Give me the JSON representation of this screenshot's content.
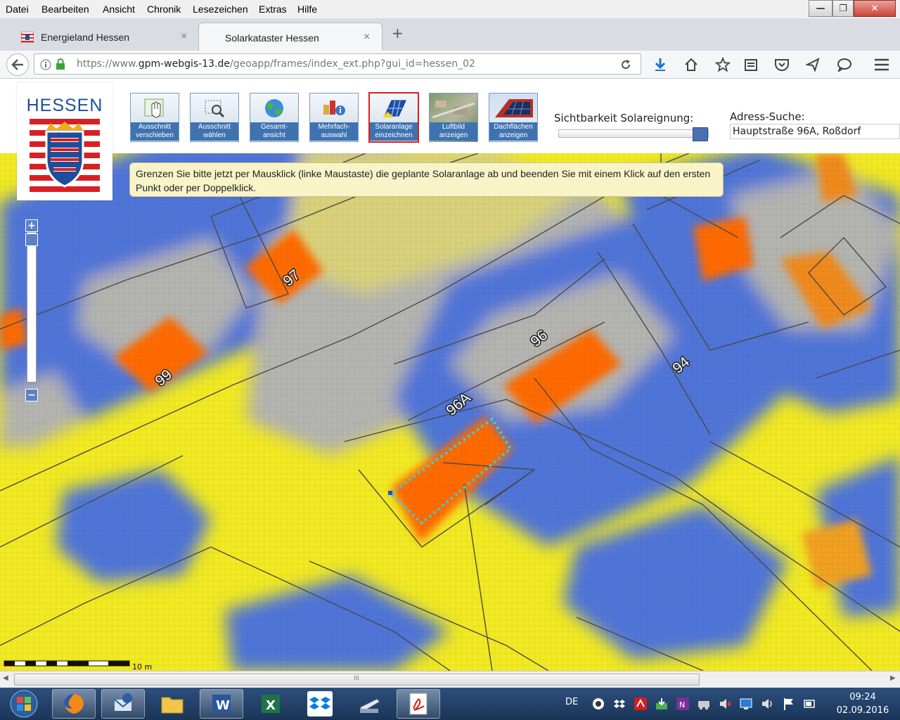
{
  "menubar": {
    "items": [
      "Datei",
      "Bearbeiten",
      "Ansicht",
      "Chronik",
      "Lesezeichen",
      "Extras",
      "Hilfe"
    ]
  },
  "window_controls": {
    "minimize": "—",
    "maximize": "❐",
    "close": "✕"
  },
  "tabs": [
    {
      "label": "Energieland Hessen",
      "close": "×"
    },
    {
      "label": "Solarkataster Hessen",
      "close": "×"
    }
  ],
  "new_tab": "+",
  "url": {
    "prefix": "https://www.",
    "domain": "gpm-webgis-13.de",
    "path": "/geoapp/frames/index_ext.php?gui_id=hessen_02"
  },
  "logo": {
    "text": "HESSEN"
  },
  "toolbar": [
    {
      "line1": "Ausschnitt",
      "line2": "verschieben",
      "icon": "pan-hand-icon"
    },
    {
      "line1": "Ausschnitt",
      "line2": "wählen",
      "icon": "zoom-box-icon"
    },
    {
      "line1": "Gesamt-",
      "line2": "ansicht",
      "icon": "globe-icon"
    },
    {
      "line1": "Mehrfach-",
      "line2": "auswahl",
      "icon": "multi-select-icon"
    },
    {
      "line1": "Solaranlage",
      "line2": "einzeichnen",
      "icon": "solar-panel-icon"
    },
    {
      "line1": "Luftbild",
      "line2": "anzeigen",
      "icon": "aerial-photo-icon"
    },
    {
      "line1": "Dachflächen",
      "line2": "anzeigen",
      "icon": "roof-icon"
    }
  ],
  "visibility": {
    "label": "Sichtbarkeit Solareignung:",
    "value_fraction": 1.0
  },
  "address": {
    "label": "Adress-Suche:",
    "value": "Hauptstraße 96A, Roßdorf"
  },
  "tooltip": {
    "text": "Grenzen Sie bitte jetzt per Mausklick (linke Maustaste) die geplante Solaranlage ab und beenden Sie mit einem Klick auf den ersten Punkt oder per Doppelklick."
  },
  "zoom": {
    "plus": "+",
    "minus": "−"
  },
  "map_labels": [
    "94",
    "97",
    "99",
    "96",
    "96A"
  ],
  "scale": {
    "label": "10 m"
  },
  "scrollbar": {
    "grip": "III",
    "left": "◀",
    "right": "▶"
  },
  "taskbar": {
    "apps": [
      "windows-start",
      "firefox",
      "thunderbird",
      "file-explorer",
      "word",
      "excel",
      "dropbox",
      "scanner",
      "acrobat"
    ],
    "lang": "DE",
    "time": "09:24",
    "date": "02.09.2016"
  },
  "colors": {
    "suitability_high": "#ff6a00",
    "suitability_mid": "#f2ea22",
    "suitability_low": "#4f75d8",
    "neutral": "#b4b4b0",
    "selection_outline": "#26d6f0",
    "toolbar_label_bg": "#3f73b0",
    "selected_tool_border": "#d8201e"
  }
}
